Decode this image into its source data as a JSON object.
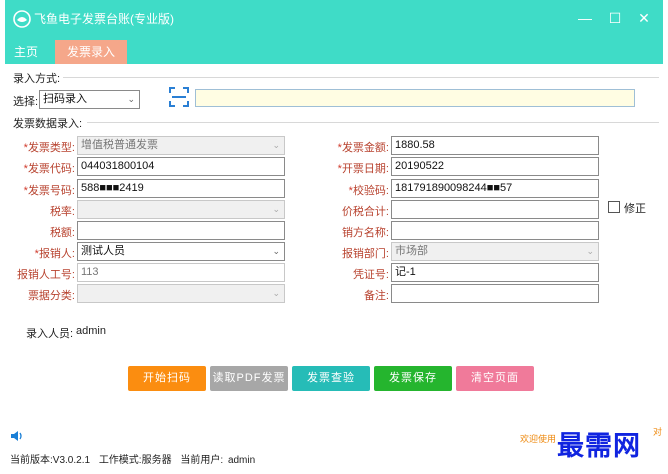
{
  "window": {
    "title": "飞鱼电子发票台账(专业版)",
    "min_icon": "minimize-icon",
    "max_icon": "maximize-icon",
    "close_icon": "close-icon"
  },
  "tabs": [
    {
      "label": "主页",
      "active": false
    },
    {
      "label": "发票录入",
      "active": true
    }
  ],
  "entry_mode": {
    "section_label": "录入方式:",
    "select_label": "选择:",
    "select_value": "扫码录入",
    "scan_input_value": ""
  },
  "invoice": {
    "section_label": "发票数据录入:",
    "left": [
      {
        "label": "发票类型:",
        "required": true,
        "value": "增值税普通发票",
        "kind": "select",
        "disabled": true
      },
      {
        "label": "发票代码:",
        "required": true,
        "value": "044031800104",
        "kind": "text"
      },
      {
        "label": "发票号码:",
        "required": true,
        "value": "588■■■2419",
        "kind": "text"
      },
      {
        "label": "税率:",
        "required": false,
        "value": "",
        "kind": "select",
        "disabled": true
      },
      {
        "label": "税额:",
        "required": false,
        "value": "",
        "kind": "text"
      },
      {
        "label": "报销人:",
        "required": true,
        "value": "测试人员",
        "kind": "select"
      },
      {
        "label": "报销人工号:",
        "required": false,
        "value": "113",
        "kind": "text",
        "readonly": true
      },
      {
        "label": "票据分类:",
        "required": false,
        "value": "",
        "kind": "select",
        "disabled": true
      }
    ],
    "right": [
      {
        "label": "发票金额:",
        "required": true,
        "value": "1880.58",
        "kind": "text"
      },
      {
        "label": "开票日期:",
        "required": true,
        "value": "20190522",
        "kind": "text"
      },
      {
        "label": "校验码:",
        "required": true,
        "value": "181791890098244■■57",
        "kind": "text"
      },
      {
        "label": "价税合计:",
        "required": false,
        "value": "",
        "kind": "text"
      },
      {
        "label": "销方名称:",
        "required": false,
        "value": "",
        "kind": "text"
      },
      {
        "label": "报销部门:",
        "required": false,
        "value": "市场部",
        "kind": "select",
        "disabled": true
      },
      {
        "label": "凭证号:",
        "required": false,
        "value": "记-1",
        "kind": "text"
      },
      {
        "label": "备注:",
        "required": false,
        "value": "",
        "kind": "text"
      }
    ],
    "correction_label": "修正",
    "correction_checked": false
  },
  "recorder": {
    "label": "录入人员:",
    "value": "admin"
  },
  "buttons": {
    "start_scan": "开始扫码",
    "read_pdf": "读取PDF发票",
    "check": "发票查验",
    "save": "发票保存",
    "clear": "清空页面"
  },
  "footer": {
    "welcome": "欢迎使用",
    "version": "当前版本:V3.0.2.1",
    "mode": "工作模式:服务器",
    "user_label": "当前用户:",
    "user": "admin",
    "speaker_icon": "speaker-icon"
  },
  "watermark": "最需网",
  "colors": {
    "titlebar": "#3fdcc7",
    "active_tab": "#f5a78a",
    "btn_start": "#fb8d10",
    "btn_pdf": "#a7a7a7",
    "btn_check": "#26bcb7",
    "btn_save": "#25b52e",
    "btn_clear": "#f07a9a",
    "required_mark": "#d03b2c",
    "watermark": "#1024e0"
  }
}
